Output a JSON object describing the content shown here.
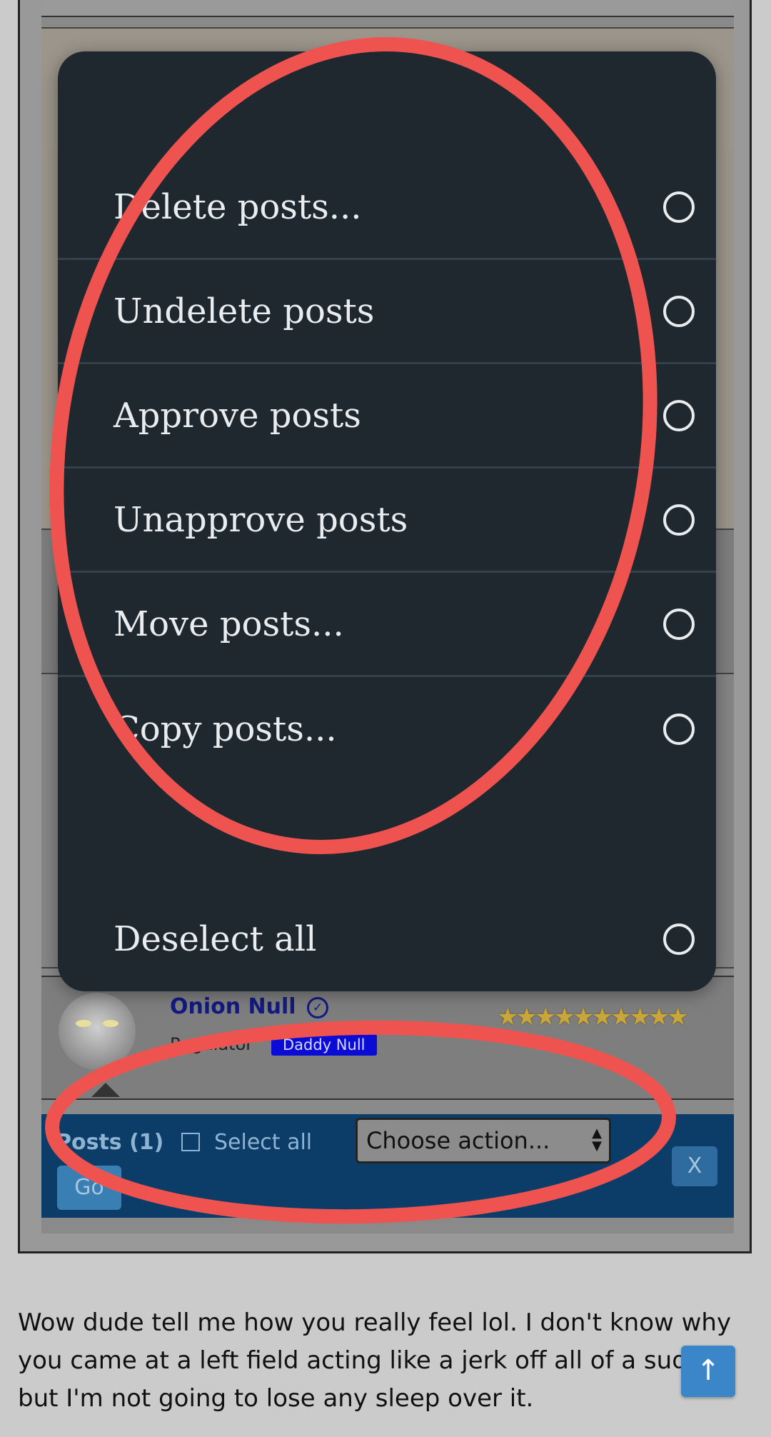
{
  "action_menu": {
    "items": [
      {
        "label": "Delete posts..."
      },
      {
        "label": "Undelete posts"
      },
      {
        "label": "Approve posts"
      },
      {
        "label": "Unapprove posts"
      },
      {
        "label": "Move posts..."
      },
      {
        "label": "Copy posts..."
      },
      {
        "label": "Deselect all"
      }
    ]
  },
  "post": {
    "username": "Onion Null",
    "role": "Regulator",
    "badge": "Daddy Null",
    "star_count": 10
  },
  "mod_bar": {
    "count_label": "Posts (1)",
    "select_all_label": "Select all",
    "action_select_value": "Choose action...",
    "go_label": "Go",
    "close_label": "X"
  },
  "comment": {
    "text": "Wow dude tell me how you really feel lol. I don't know why you came at a left field acting like a jerk off all of a sudden but I'm not going to lose any sleep over it."
  },
  "colors": {
    "menu_bg": "#1f272f",
    "annotation_red": "#ef5350",
    "mod_bar_bg": "#0c3d68"
  }
}
